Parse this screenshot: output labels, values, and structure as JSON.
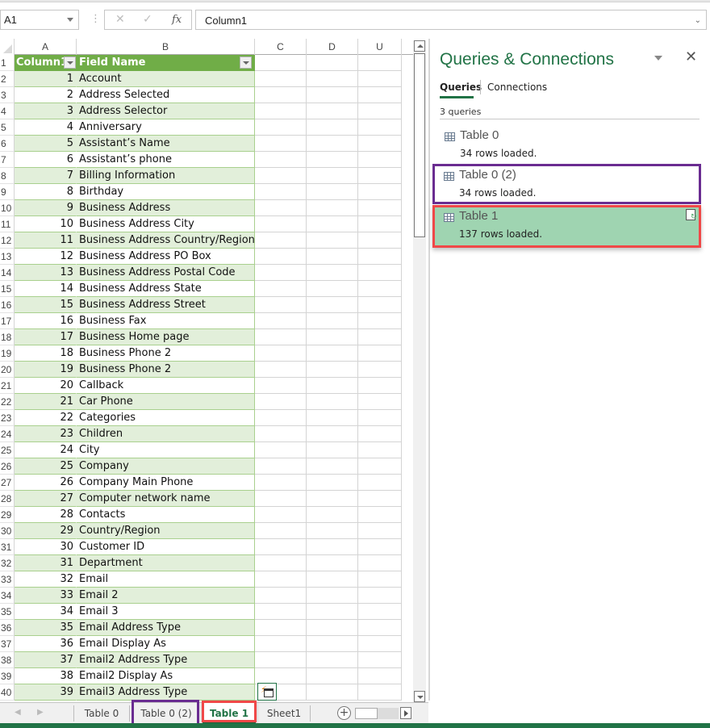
{
  "formula_bar": {
    "name_box": "A1",
    "cancel_icon": "✕",
    "enter_icon": "✓",
    "fx_label": "fx",
    "formula_value": "Column1"
  },
  "grid": {
    "column_headers": [
      "A",
      "B",
      "C",
      "D",
      "U"
    ],
    "table_headers": [
      "Column1",
      "Field Name"
    ],
    "rows": [
      {
        "n": "2",
        "a": "1",
        "b": "Account"
      },
      {
        "n": "3",
        "a": "2",
        "b": "Address Selected"
      },
      {
        "n": "4",
        "a": "3",
        "b": "Address Selector"
      },
      {
        "n": "5",
        "a": "4",
        "b": "Anniversary"
      },
      {
        "n": "6",
        "a": "5",
        "b": "Assistant’s Name"
      },
      {
        "n": "7",
        "a": "6",
        "b": "Assistant’s phone"
      },
      {
        "n": "8",
        "a": "7",
        "b": "Billing Information"
      },
      {
        "n": "9",
        "a": "8",
        "b": "Birthday"
      },
      {
        "n": "10",
        "a": "9",
        "b": "Business Address"
      },
      {
        "n": "11",
        "a": "10",
        "b": "Business Address City"
      },
      {
        "n": "12",
        "a": "11",
        "b": "Business Address Country/Region"
      },
      {
        "n": "13",
        "a": "12",
        "b": "Business Address PO Box"
      },
      {
        "n": "14",
        "a": "13",
        "b": "Business Address Postal Code"
      },
      {
        "n": "15",
        "a": "14",
        "b": "Business Address State"
      },
      {
        "n": "16",
        "a": "15",
        "b": "Business Address Street"
      },
      {
        "n": "17",
        "a": "16",
        "b": "Business Fax"
      },
      {
        "n": "18",
        "a": "17",
        "b": "Business Home page"
      },
      {
        "n": "19",
        "a": "18",
        "b": "Business Phone 2"
      },
      {
        "n": "20",
        "a": "19",
        "b": "Business Phone 2"
      },
      {
        "n": "21",
        "a": "20",
        "b": "Callback"
      },
      {
        "n": "22",
        "a": "21",
        "b": "Car Phone"
      },
      {
        "n": "23",
        "a": "22",
        "b": "Categories"
      },
      {
        "n": "24",
        "a": "23",
        "b": "Children"
      },
      {
        "n": "25",
        "a": "24",
        "b": "City"
      },
      {
        "n": "26",
        "a": "25",
        "b": "Company"
      },
      {
        "n": "27",
        "a": "26",
        "b": "Company Main Phone"
      },
      {
        "n": "28",
        "a": "27",
        "b": "Computer network name"
      },
      {
        "n": "29",
        "a": "28",
        "b": "Contacts"
      },
      {
        "n": "30",
        "a": "29",
        "b": "Country/Region"
      },
      {
        "n": "31",
        "a": "30",
        "b": "Customer ID"
      },
      {
        "n": "32",
        "a": "31",
        "b": "Department"
      },
      {
        "n": "33",
        "a": "32",
        "b": "Email"
      },
      {
        "n": "34",
        "a": "33",
        "b": "Email 2"
      },
      {
        "n": "35",
        "a": "34",
        "b": "Email 3"
      },
      {
        "n": "36",
        "a": "35",
        "b": "Email Address Type"
      },
      {
        "n": "37",
        "a": "36",
        "b": "Email Display As"
      },
      {
        "n": "38",
        "a": "37",
        "b": "Email2 Address Type"
      },
      {
        "n": "39",
        "a": "38",
        "b": "Email2 Display As"
      },
      {
        "n": "40",
        "a": "39",
        "b": "Email3 Address Type"
      }
    ]
  },
  "queries_pane": {
    "title": "Queries & Connections",
    "close_icon": "✕",
    "tabs": [
      "Queries",
      "Connections"
    ],
    "active_tab": "Queries",
    "count_label": "3 queries",
    "queries": [
      {
        "name": "Table 0",
        "status": "34 rows loaded."
      },
      {
        "name": "Table 0 (2)",
        "status": "34 rows loaded."
      },
      {
        "name": "Table 1",
        "status": "137 rows loaded."
      }
    ]
  },
  "sheet_tabs": {
    "tabs": [
      "Table 0",
      "Table 0 (2)",
      "Table 1",
      "Sheet1"
    ],
    "active": "Table 1",
    "nav_prev": "◀",
    "nav_next": "▶",
    "add_icon": "+"
  },
  "colors": {
    "accent": "#217346",
    "table_header": "#70ad47",
    "band": "#e2efda",
    "selected_query": "#9fd4b1",
    "highlight_purple": "#6a2c91",
    "highlight_red": "#f04848"
  }
}
